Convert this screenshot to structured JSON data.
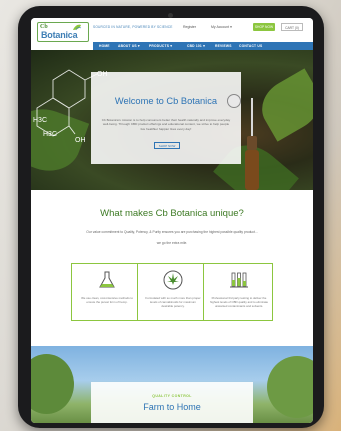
{
  "header": {
    "logo_top": "Cb",
    "logo_name": "Botanica",
    "tagline": "SOURCED IN NATURE, POWERED BY SCIENCE",
    "login": "Register",
    "account": "My Account ▾",
    "shop_label": "SHOP NOW",
    "cart_label": "CART (0)"
  },
  "nav": {
    "items": [
      "HOME",
      "ABOUT US ▾",
      "PRODUCTS ▾",
      "CBD 101 ▾",
      "REVIEWS",
      "CONTACT US"
    ]
  },
  "hero": {
    "title": "Welcome to Cb Botanica",
    "description": "Cb Botanica’s mission is to help consumers better their health naturally and improve everyday well-being. Through CBD product offerings and educational content, we strive to help people live healthier happier lives every day!",
    "button": "SHOP NOW",
    "molecule_labels": [
      "OH",
      "OH",
      "H3C",
      "H3C"
    ]
  },
  "unique": {
    "title": "What makes Cb Botanica unique?",
    "desc_line1": "Our value commitment to Quality, Potency, & Purity ensures you are purchasing the highest possible quality product...",
    "desc_line2": "we go the extra mile.",
    "cards": [
      {
        "icon": "lab-flask-icon",
        "text": "We use clean, cost-intensive methods to ensure the purest form of hemp."
      },
      {
        "icon": "cannabis-leaf-icon",
        "text": "Formulated with so much more than proper levels of cannabinoids for maximum desirable potency."
      },
      {
        "icon": "test-tubes-icon",
        "text": "Professional 3rd party testing to deliver the highest levels of CBD quality and to eliminate unwanted contaminants and solvents."
      }
    ]
  },
  "quality": {
    "label": "QUALITY CONTROL",
    "title": "Farm to Home"
  },
  "colors": {
    "brand_blue": "#2e74b5",
    "brand_green": "#8cc63f",
    "title_green": "#3d7a24"
  }
}
